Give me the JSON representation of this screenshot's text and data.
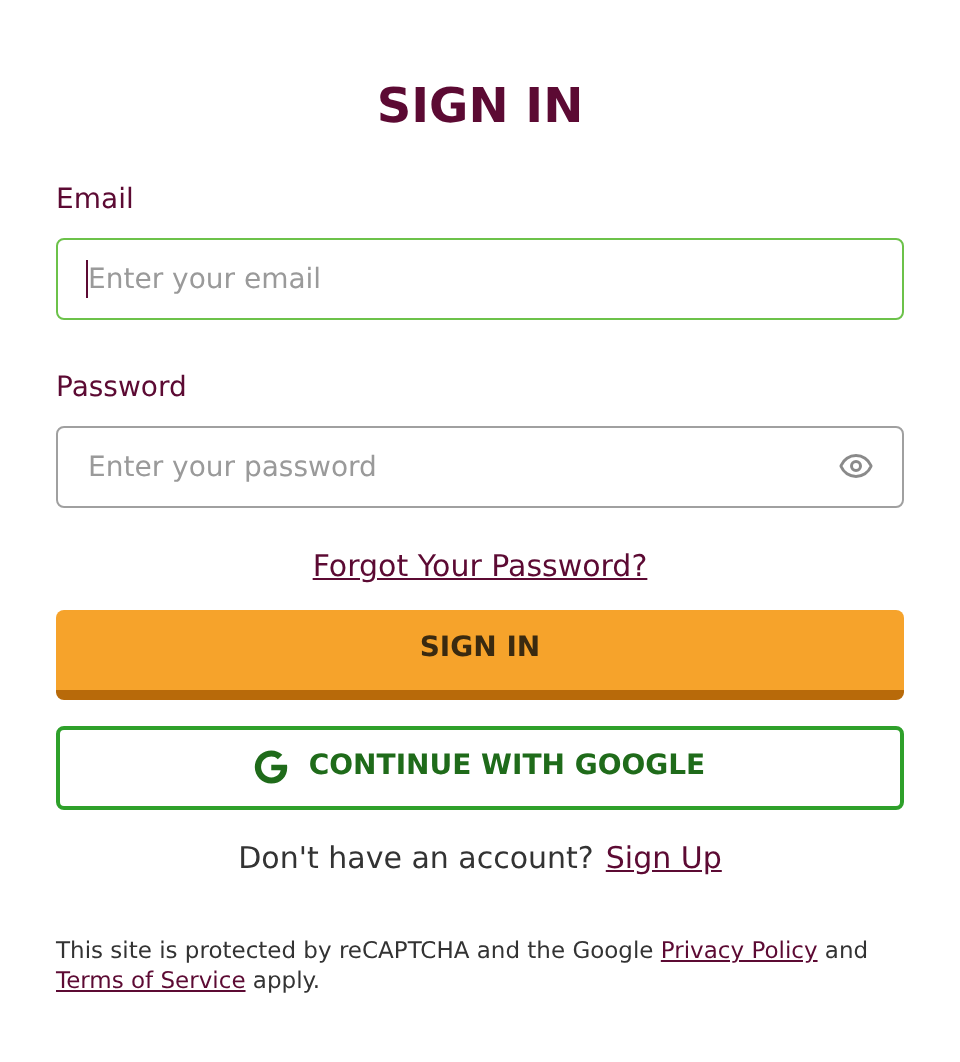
{
  "title": "SIGN IN",
  "fields": [
    {
      "label": "Email",
      "placeholder": "Enter your email",
      "focused": true,
      "kind": "text"
    },
    {
      "label": "Password",
      "placeholder": "Enter your password",
      "focused": false,
      "kind": "password"
    }
  ],
  "forgot_link": "Forgot Your Password?",
  "sign_in_button": "SIGN IN",
  "google_button": "CONTINUE WITH GOOGLE",
  "signup": {
    "text": "Don't have an account?",
    "link": "Sign Up"
  },
  "footer": [
    {
      "kind": "text",
      "text": "This site is protected by reCAPTCHA and the Google "
    },
    {
      "kind": "link",
      "text": "Privacy Policy"
    },
    {
      "kind": "text",
      "text": " and "
    },
    {
      "kind": "link",
      "text": "Terms of Service"
    },
    {
      "kind": "text",
      "text": " apply."
    }
  ]
}
